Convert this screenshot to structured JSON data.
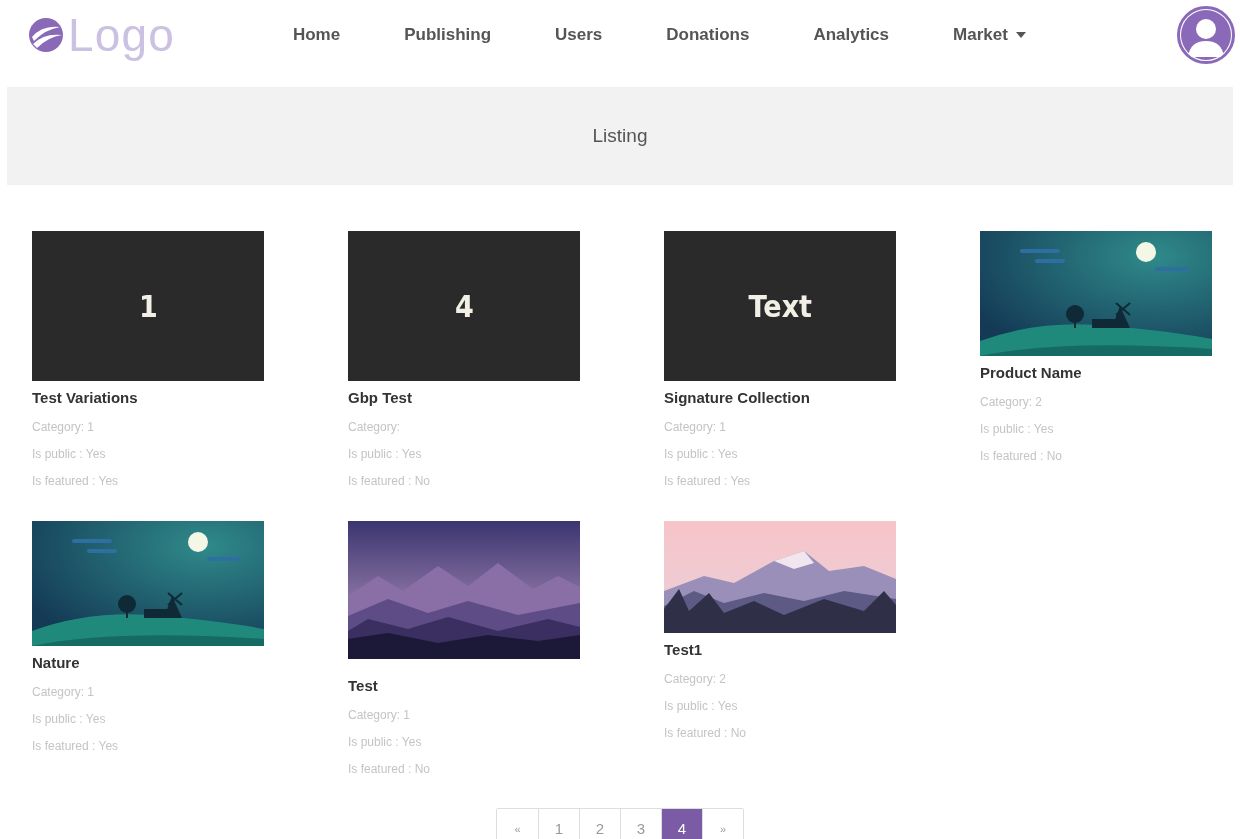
{
  "header": {
    "logo": "Logo",
    "nav": [
      {
        "label": "Home",
        "kind": "link"
      },
      {
        "label": "Publishing",
        "kind": "link"
      },
      {
        "label": "Users",
        "kind": "link"
      },
      {
        "label": "Donations",
        "kind": "link"
      },
      {
        "label": "Analytics",
        "kind": "link"
      },
      {
        "label": "Market",
        "kind": "dropdown"
      }
    ]
  },
  "banner": {
    "title": "Listing"
  },
  "listings": [
    {
      "title": "Test Variations",
      "thumbnail": {
        "kind": "text_tile",
        "label": "1"
      },
      "category": "Category: 1",
      "is_public": "Is public : Yes",
      "is_featured": "Is featured : Yes"
    },
    {
      "title": "Gbp Test",
      "thumbnail": {
        "kind": "text_tile",
        "label": "4"
      },
      "category": "Category:",
      "is_public": "Is public : Yes",
      "is_featured": "Is featured : No"
    },
    {
      "title": "Signature Collection",
      "thumbnail": {
        "kind": "text_tile",
        "label": "Text"
      },
      "category": "Category: 1",
      "is_public": "Is public : Yes",
      "is_featured": "Is featured : Yes"
    },
    {
      "title": "Product Name",
      "category": "Category: 2",
      "is_public": "Is public : Yes",
      "is_featured": "Is featured : No"
    },
    {
      "title": "Nature",
      "category": "Category: 1",
      "is_public": "Is public : Yes",
      "is_featured": "Is featured : Yes"
    },
    {
      "title": "Test",
      "category": "Category: 1",
      "is_public": "Is public : Yes",
      "is_featured": "Is featured : No"
    },
    {
      "title": "Test1",
      "category": "Category: 2",
      "is_public": "Is public : Yes",
      "is_featured": "Is featured : No"
    }
  ],
  "pagination": [
    {
      "label": "«",
      "selected": false
    },
    {
      "label": "1",
      "selected": false
    },
    {
      "label": "2",
      "selected": false
    },
    {
      "label": "3",
      "selected": false
    },
    {
      "label": "4",
      "selected": true
    },
    {
      "label": "»",
      "selected": false
    }
  ]
}
